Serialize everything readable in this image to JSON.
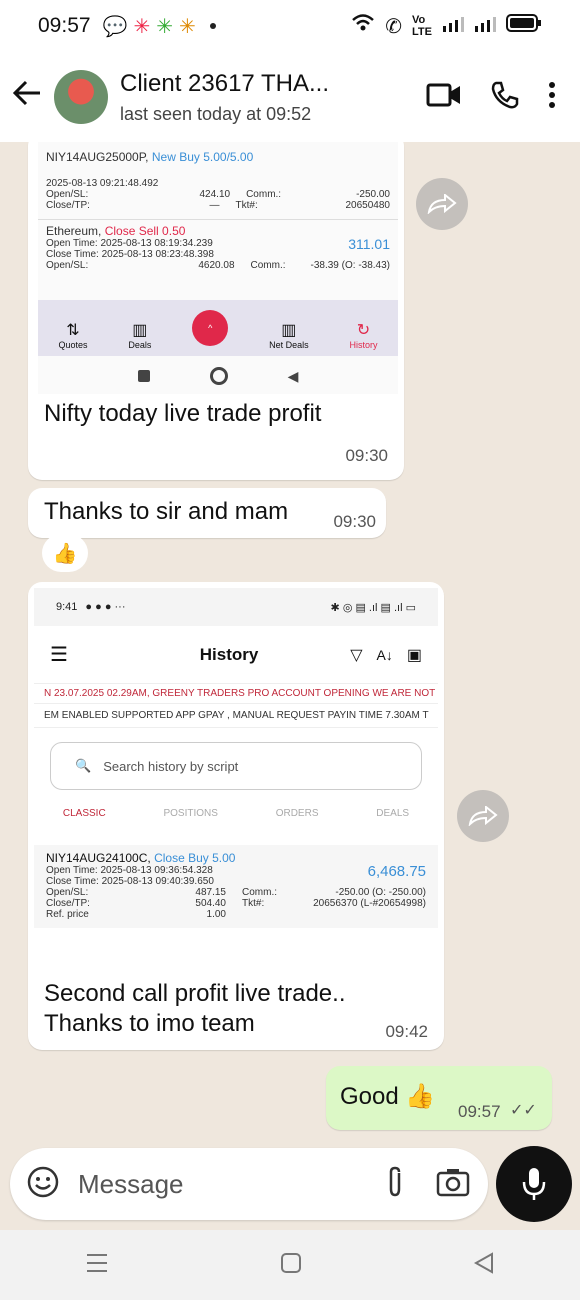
{
  "status": {
    "time": "09:57"
  },
  "header": {
    "title": "Client 23617 THA...",
    "subtitle": "last seen today at 09:52"
  },
  "msg1": {
    "trade1": {
      "symbol": "NIY14AUG25000P,",
      "action": "New Buy 5.00/5.00",
      "timestamp": "2025-08-13 09:21:48.492",
      "open_label": "Open/SL:",
      "open_val": "424.10",
      "comm_label": "Comm.:",
      "comm_val": "-250.00",
      "close_label": "Close/TP:",
      "close_val": "—",
      "tkt_label": "Tkt#:",
      "tkt_val": "20650480"
    },
    "trade2": {
      "symbol": "Ethereum,",
      "action": "Close Sell 0.50",
      "profit": "311.01",
      "open_time": "Open Time: 2025-08-13 08:19:34.239",
      "close_time": "Close Time: 2025-08-13 08:23:48.398",
      "open_label": "Open/SL:",
      "open_val": "4620.08",
      "comm_label": "Comm.:",
      "comm_val": "-38.39 (O: -38.43)"
    },
    "tabs": [
      "Quotes",
      "Deals",
      "Net Deals",
      "History"
    ],
    "caption": "Nifty today live trade profit",
    "time": "09:30"
  },
  "msg2": {
    "text": "Thanks to sir and mam",
    "time": "09:30",
    "reaction": "👍"
  },
  "msg3": {
    "phone_time": "9:41",
    "title": "History",
    "ticker1": "N 23.07.2025 02.29AM, GREENY TRADERS PRO ACCOUNT OPENING WE ARE NOT",
    "ticker2": "EM ENABLED SUPPORTED APP GPAY , MANUAL REQUEST PAYIN TIME 7.30AM  T",
    "search_placeholder": "Search history by script",
    "tabs": [
      "CLASSIC",
      "POSITIONS",
      "ORDERS",
      "DEALS"
    ],
    "trade": {
      "symbol": "NIY14AUG24100C,",
      "action": "Close Buy 5.00",
      "profit": "6,468.75",
      "open_time": "Open Time: 2025-08-13 09:36:54.328",
      "close_time": "Close Time: 2025-08-13 09:40:39.650",
      "open_label": "Open/SL:",
      "open_val": "487.15",
      "comm_label": "Comm.:",
      "comm_val": "-250.00 (O: -250.00)",
      "close_label": "Close/TP:",
      "close_val": "504.40",
      "tkt_label": "Tkt#:",
      "tkt_val": "20656370 (L-#20654998)",
      "ref_label": "Ref. price",
      "ref_val": "1.00"
    },
    "caption_line1": "Second call profit live trade..",
    "caption_line2": "Thanks to imo team",
    "time": "09:42"
  },
  "msg4": {
    "text": "Good 👍",
    "time": "09:57"
  },
  "input": {
    "placeholder": "Message"
  },
  "colors": {
    "accent_red": "#e0284a",
    "blue": "#3a8fd6",
    "sent_bubble": "#dcf8c6"
  }
}
